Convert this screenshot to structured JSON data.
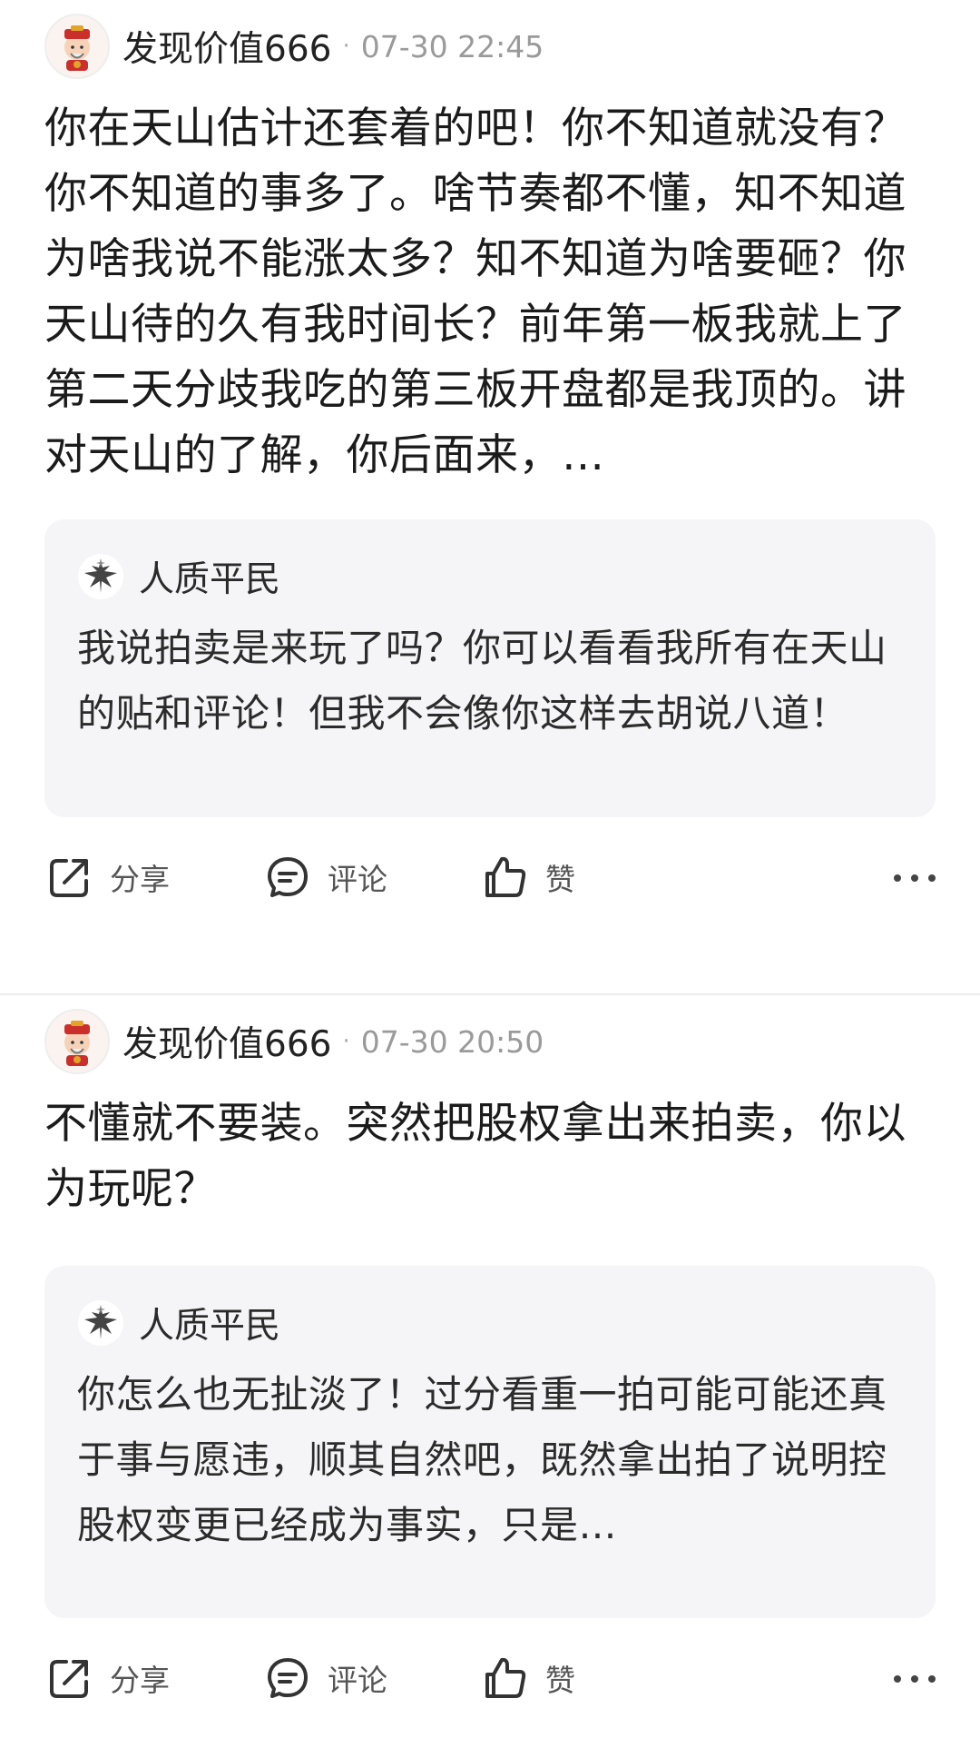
{
  "posts": [
    {
      "author": "发现价值666",
      "separator": "·",
      "timestamp": "07-30 22:45",
      "content": "你在天山估计还套着的吧！你不知道就没有？你不知道的事多了。啥节奏都不懂，知不知道为啥我说不能涨太多？知不知道为啥要砸？你天山待的久有我时间长？前年第一板我就上了第二天分歧我吃的第三板开盘都是我顶的。讲对天山的了解，你后面来，…",
      "quote": {
        "author": "人质平民",
        "text": "我说拍卖是来玩了吗？你可以看看我所有在天山的贴和评论！但我不会像你这样去胡说八道！"
      },
      "actions": {
        "share": "分享",
        "comment": "评论",
        "like": "赞"
      }
    },
    {
      "author": "发现价值666",
      "separator": "·",
      "timestamp": "07-30 20:50",
      "content": "不懂就不要装。突然把股权拿出来拍卖，你以为玩呢？",
      "quote": {
        "author": "人质平民",
        "text": "你怎么也无扯淡了！过分看重一拍可能可能还真于事与愿违，顺其自然吧，既然拿出拍了说明控股权变更已经成为事实，只是…"
      },
      "actions": {
        "share": "分享",
        "comment": "评论",
        "like": "赞"
      }
    }
  ],
  "icons": {
    "avatar": "cartoon-fortune-god-avatar",
    "quote_avatar": "bird-emblem-avatar",
    "share": "share-icon",
    "comment": "comment-icon",
    "like": "thumbs-up-icon",
    "more": "more-dots-icon"
  },
  "colors": {
    "quote_bg": "#f5f5f7",
    "meta_gray": "#9a9a9a"
  }
}
